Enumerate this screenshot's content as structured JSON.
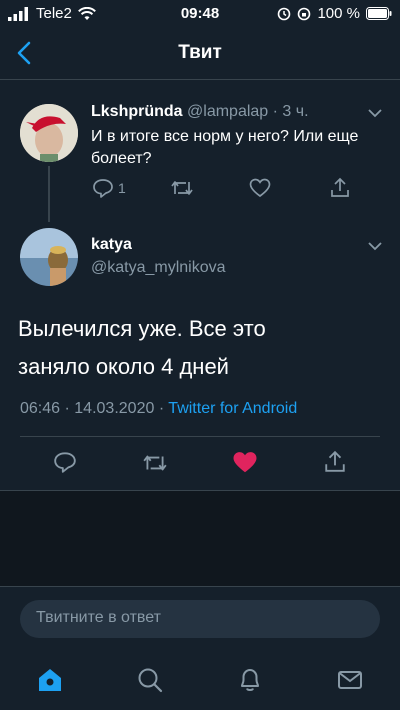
{
  "status_bar": {
    "carrier": "Tele2",
    "time": "09:48",
    "battery": "100 %"
  },
  "nav": {
    "title": "Твит"
  },
  "reply_tweet": {
    "display_name": "Lkshpründa",
    "handle": "@lampalap",
    "separator": "·",
    "age": "3 ч.",
    "text": "И в итоге все норм у него? Или еще болеет?",
    "reply_count": "1"
  },
  "main_tweet": {
    "display_name": "katya",
    "handle": "@katya_mylnikova",
    "text_line1": "Вылечился уже. Все это",
    "text_line2": "заняло около 4 дней",
    "time": "06:46",
    "date": "14.03.2020",
    "dot": "·",
    "source": "Twitter for Android",
    "liked": true
  },
  "reply_box": {
    "placeholder": "Твитните в ответ"
  },
  "colors": {
    "background": "#15202b",
    "accent": "#1da1f2",
    "like": "#e0245e",
    "muted": "#8899a6"
  },
  "tabs": [
    "home-icon",
    "search-icon",
    "bell-icon",
    "mail-icon"
  ]
}
